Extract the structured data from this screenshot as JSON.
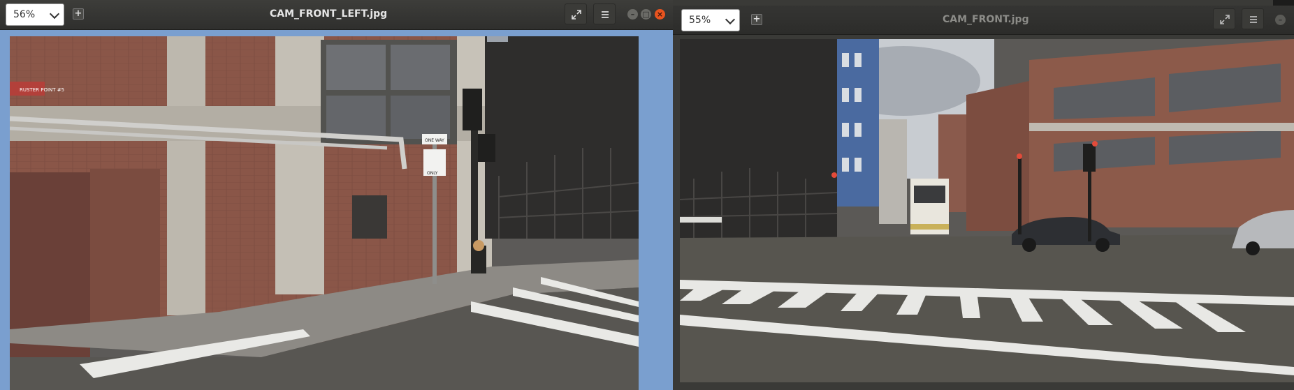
{
  "left_window": {
    "zoom_value": "56%",
    "title": "CAM_FRONT_LEFT.jpg",
    "icons": {
      "add": "plus-icon",
      "fullscreen": "fullscreen-icon",
      "menu": "hamburger-menu-icon",
      "minimize": "minimize-icon",
      "maximize": "maximize-icon",
      "close": "close-icon"
    },
    "image_text": {
      "sign_top": "ONE WAY",
      "sign_small": "RUSTER POINT #5",
      "sign_only": "ONLY"
    }
  },
  "right_window": {
    "zoom_value": "55%",
    "title": "CAM_FRONT.jpg",
    "icons": {
      "add": "plus-icon",
      "fullscreen": "fullscreen-icon",
      "menu": "hamburger-menu-icon",
      "minimize": "minimize-icon"
    }
  },
  "colors": {
    "window_bg": "#7a9fcf",
    "titlebar": "#353533",
    "close_button": "#e9541f"
  }
}
